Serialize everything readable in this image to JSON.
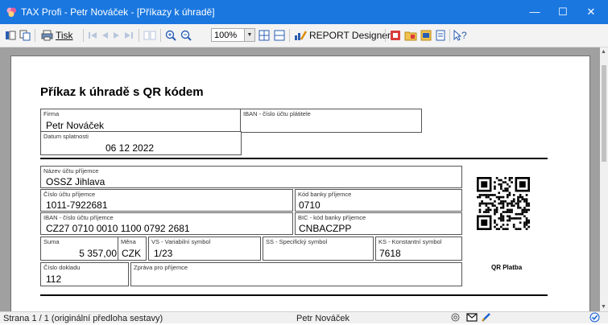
{
  "window": {
    "title": "TAX Profi - Petr Nováček - [Příkazy k úhradě]",
    "minimize": "—",
    "maximize": "☐",
    "close": "✕"
  },
  "toolbar": {
    "print_label": "Tisk",
    "zoom_value": "100%",
    "report_designer_label": "REPORT Designer",
    "help_label": "?"
  },
  "form": {
    "title": "Příkaz k úhradě s QR kódem",
    "firma_label": "Firma",
    "firma_value": "Petr Nováček",
    "iban_payer_label": "IBAN - číslo účtu plátitele",
    "datum_label": "Datum splatnosti",
    "datum_value": "06 12 2022",
    "nazev_label": "Název účtu příjemce",
    "nazev_value": "OSSZ Jihlava",
    "cislo_label": "Číslo účtu příjemce",
    "cislo_value": "1011-7922681",
    "kod_label": "Kód banky příjemce",
    "kod_value": "0710",
    "iban_label": "IBAN - číslo účtu příjemce",
    "iban_value": "CZ27 0710 0010 1100 0792 2681",
    "bic_label": "BIC - kód banky příjemce",
    "bic_value": "CNBACZPP",
    "suma_label": "Suma",
    "suma_value": "5 357,00",
    "mena_label": "Měna",
    "mena_value": "CZK",
    "vs_label": "VS - Variabilní symbol",
    "vs_value": "1/23",
    "ss_label": "SS - Specifický symbol",
    "ks_label": "KS - Konstantní symbol",
    "ks_value": "7618",
    "doklad_label": "Číslo dokladu",
    "doklad_value": "112",
    "zprava_label": "Zpráva pro příjemce",
    "qr_label": "QR Platba"
  },
  "statusbar": {
    "page_info": "Strana 1 / 1  (originální předloha sestavy)",
    "user": "Petr Nováček"
  },
  "colors": {
    "titlebar": "#1a77e0",
    "workarea": "#a0a0a0"
  }
}
